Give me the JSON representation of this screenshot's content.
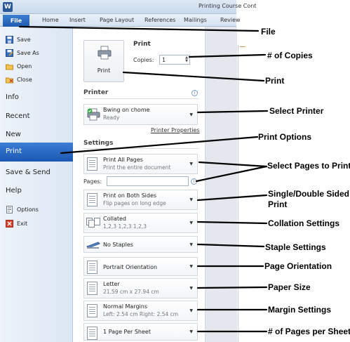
{
  "titlebar": {
    "app_icon": "W",
    "doc_title": "Printing Course Cont"
  },
  "ribbon": {
    "file_tab": "File",
    "tabs": [
      "Home",
      "Insert",
      "Page Layout",
      "References",
      "Mailings",
      "Review"
    ]
  },
  "nav": {
    "top_items": [
      {
        "label": "Save",
        "icon": "save-icon"
      },
      {
        "label": "Save As",
        "icon": "save-as-icon"
      },
      {
        "label": "Open",
        "icon": "open-folder-icon"
      },
      {
        "label": "Close",
        "icon": "close-folder-icon"
      }
    ],
    "info": "Info",
    "recent": "Recent",
    "new": "New",
    "print": "Print",
    "save_send": "Save & Send",
    "help": "Help",
    "bottom_items": [
      {
        "label": "Options",
        "icon": "options-icon"
      },
      {
        "label": "Exit",
        "icon": "exit-icon"
      }
    ]
  },
  "print_panel": {
    "heading": "Print",
    "button_label": "Print",
    "copies_label": "Copies:",
    "copies_value": "1",
    "printer_heading": "Printer",
    "printer_name": "Bwing on chome",
    "printer_status": "Ready",
    "printer_properties": "Printer Properties",
    "settings_heading": "Settings",
    "pages_label": "Pages:",
    "settings": [
      {
        "line1": "Print All Pages",
        "line2": "Print the entire document"
      },
      {
        "line1": "Print on Both Sides",
        "line2": "Flip pages on long edge"
      },
      {
        "line1": "Collated",
        "line2": "1,2,3    1,2,3    1,2,3"
      },
      {
        "line1": "No Staples",
        "line2": ""
      },
      {
        "line1": "Portrait Orientation",
        "line2": ""
      },
      {
        "line1": "Letter",
        "line2": "21.59 cm x 27.94 cm"
      },
      {
        "line1": "Normal Margins",
        "line2": "Left: 2.54 cm   Right: 2.54 cm"
      },
      {
        "line1": "1 Page Per Sheet",
        "line2": ""
      }
    ]
  },
  "annotations": {
    "file": "File",
    "copies": "# of Copies",
    "print": "Print",
    "select_printer": "Select Printer",
    "print_options": "Print Options",
    "select_pages": "Select Pages to Print",
    "sides_1": "Single/Double Sided",
    "sides_2": "Print",
    "collation": "Collation Settings",
    "staple": "Staple Settings",
    "orientation": "Page Orientation",
    "paper": "Paper Size",
    "margins": "Margin Settings",
    "pages_per_sheet": "# of Pages per Sheet"
  },
  "colors": {
    "accent_blue": "#1f5bb0",
    "nav_background": "#dbe6f4",
    "annotation_text": "#000000"
  }
}
